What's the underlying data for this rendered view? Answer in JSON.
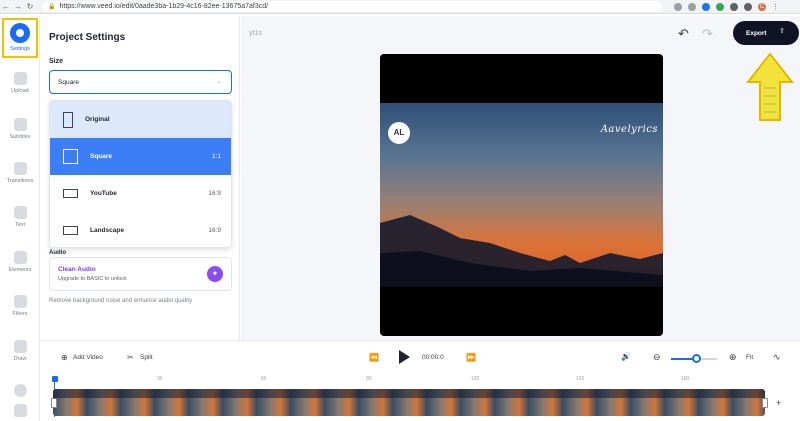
{
  "browser": {
    "url": "https://www.veed.io/edit/0aade3ba-1b29-4c16-82ee-13675a7af3cd/",
    "back": "←",
    "forward": "→",
    "reload": "↻",
    "avatar_letter": "C"
  },
  "rail": {
    "items": [
      {
        "label": "Settings",
        "icon": "settings-icon",
        "active": true
      },
      {
        "label": "Upload",
        "icon": "upload-icon"
      },
      {
        "label": "Subtitles",
        "icon": "subtitles-icon"
      },
      {
        "label": "Transitions",
        "icon": "transitions-icon"
      },
      {
        "label": "Text",
        "icon": "text-icon"
      },
      {
        "label": "Elements",
        "icon": "elements-icon"
      },
      {
        "label": "Filters",
        "icon": "filters-icon"
      },
      {
        "label": "Draw",
        "icon": "draw-icon"
      }
    ]
  },
  "panel": {
    "title": "Project Settings",
    "size_label": "Size",
    "size_value": "Square",
    "size_options": [
      {
        "label": "Original",
        "ratio": ""
      },
      {
        "label": "Square",
        "ratio": "1:1"
      },
      {
        "label": "YouTube",
        "ratio": "16:9"
      },
      {
        "label": "Landscape",
        "ratio": "16:9"
      }
    ],
    "audio_heading": "Audio",
    "clean_audio_title": "Clean Audio",
    "clean_audio_sub": "Upgrade to BASIC to unlock",
    "clean_audio_desc": "Remove background noise and enhance audio quality"
  },
  "editor": {
    "project_name": "yt1s",
    "export_label": "Export",
    "undo_glyph": "↶",
    "redo_glyph": "↷",
    "logo_text": "AL",
    "signature_text": "Aavelyrics"
  },
  "timeline": {
    "add_video_label": "Add Video",
    "add_video_glyph": "⊕",
    "split_label": "Split",
    "split_glyph": "✂",
    "time": "00:00:0",
    "fit_label": "Fit",
    "zoom_level": 0.55,
    "zoom_out_glyph": "⊖",
    "zoom_in_glyph": "⊕",
    "volume_glyph": "🔊",
    "rewind_glyph": "⏪",
    "forward_glyph": "⏩",
    "waveform_glyph": "∿",
    "add_glyph": "+",
    "ticks": [
      "0",
      "30",
      "60",
      "90",
      "120",
      "150",
      "180"
    ]
  },
  "colors": {
    "accent": "#1a6cf5",
    "annotation": "#f2c200",
    "export_bg": "#101324",
    "clean_audio": "#7b3fe4"
  }
}
